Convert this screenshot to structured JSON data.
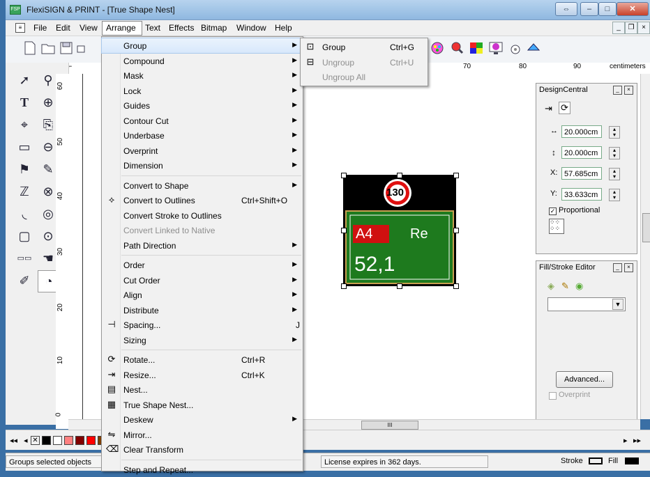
{
  "window": {
    "title": "FlexiSIGN & PRINT - [True Shape Nest]",
    "app_icon": "FSP"
  },
  "menubar": [
    "File",
    "Edit",
    "View",
    "Arrange",
    "Text",
    "Effects",
    "Bitmap",
    "Window",
    "Help"
  ],
  "ruler_top": {
    "labels": [
      "70",
      "80",
      "90"
    ],
    "unit": "centimeters"
  },
  "ruler_left": {
    "labels": [
      "60",
      "50",
      "40",
      "30",
      "20",
      "10",
      "0"
    ]
  },
  "sign": {
    "speed": "130",
    "route": "A4",
    "text_right": "Re",
    "distance": "52,1"
  },
  "arrange_menu": [
    {
      "label": "Group",
      "submenu": true,
      "highlight": true
    },
    {
      "label": "Compound",
      "submenu": true
    },
    {
      "label": "Mask",
      "submenu": true
    },
    {
      "label": "Lock",
      "submenu": true
    },
    {
      "label": "Guides",
      "submenu": true
    },
    {
      "label": "Contour Cut",
      "submenu": true
    },
    {
      "label": "Underbase",
      "submenu": true
    },
    {
      "label": "Overprint",
      "submenu": true
    },
    {
      "label": "Dimension",
      "submenu": true
    },
    {
      "sep": true
    },
    {
      "label": "Convert to Shape",
      "submenu": true
    },
    {
      "label": "Convert to Outlines",
      "shortcut": "Ctrl+Shift+O",
      "icon": "convert-outlines-icon"
    },
    {
      "label": "Convert Stroke to Outlines"
    },
    {
      "label": "Convert Linked to Native",
      "disabled": true
    },
    {
      "label": "Path Direction",
      "submenu": true
    },
    {
      "sep": true
    },
    {
      "label": "Order",
      "submenu": true
    },
    {
      "label": "Cut Order",
      "submenu": true
    },
    {
      "label": "Align",
      "submenu": true
    },
    {
      "label": "Distribute",
      "submenu": true
    },
    {
      "label": "Spacing...",
      "shortcut": "J",
      "icon": "spacing-icon"
    },
    {
      "label": "Sizing",
      "submenu": true
    },
    {
      "sep": true
    },
    {
      "label": "Rotate...",
      "shortcut": "Ctrl+R",
      "icon": "rotate-icon"
    },
    {
      "label": "Resize...",
      "shortcut": "Ctrl+K",
      "icon": "resize-icon"
    },
    {
      "label": "Nest...",
      "icon": "nest-icon"
    },
    {
      "label": "True Shape Nest...",
      "icon": "true-shape-nest-icon"
    },
    {
      "label": "Deskew",
      "submenu": true
    },
    {
      "label": "Mirror...",
      "icon": "mirror-icon"
    },
    {
      "label": "Clear Transform",
      "icon": "clear-transform-icon"
    },
    {
      "sep": true
    },
    {
      "label": "Step and Repeat..."
    }
  ],
  "group_submenu": [
    {
      "label": "Group",
      "shortcut": "Ctrl+G",
      "icon": "group-icon"
    },
    {
      "label": "Ungroup",
      "shortcut": "Ctrl+U",
      "disabled": true,
      "icon": "ungroup-icon"
    },
    {
      "label": "Ungroup All",
      "disabled": true
    }
  ],
  "design_central": {
    "title": "DesignCentral",
    "width": "20.000cm",
    "height": "20.000cm",
    "x_label": "X:",
    "x": "57.685cm",
    "y_label": "Y:",
    "y": "33.633cm",
    "proportional_label": "Proportional",
    "proportional_checked": true
  },
  "fill_stroke": {
    "title": "Fill/Stroke Editor",
    "advanced_label": "Advanced...",
    "overprint_label": "Overprint"
  },
  "status": {
    "left": "Groups selected objects",
    "license": "License expires in 362 days.",
    "stroke_label": "Stroke",
    "fill_label": "Fill"
  },
  "hscroll_thumb": "III",
  "palette": [
    "#000000",
    "#ffffff",
    "#ff8080",
    "#800000",
    "#ff0000",
    "#804000",
    "#ff8000",
    "#ffff00",
    "#80ff00",
    "#008000",
    "#00ff80",
    "#008080",
    "#00ffff",
    "#0080ff",
    "#0000ff",
    "#000080",
    "#8000ff",
    "#800080",
    "#ff00ff",
    "#ff0080",
    "#c0c0c0",
    "#808080"
  ],
  "colors": {
    "accent": "#0078d7",
    "sign_green": "#1e7a1e",
    "sign_red": "#d01010"
  }
}
